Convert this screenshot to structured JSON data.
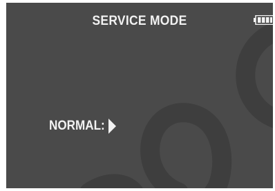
{
  "screen": {
    "title": "SERVICE MODE",
    "background_color": "#4a4a4a",
    "text_color": "#f2f2f2"
  },
  "status": {
    "battery_icon": "battery-icon"
  },
  "menu": {
    "mode_label": "NORMAL:",
    "selector_icon": "right-arrow-icon"
  }
}
